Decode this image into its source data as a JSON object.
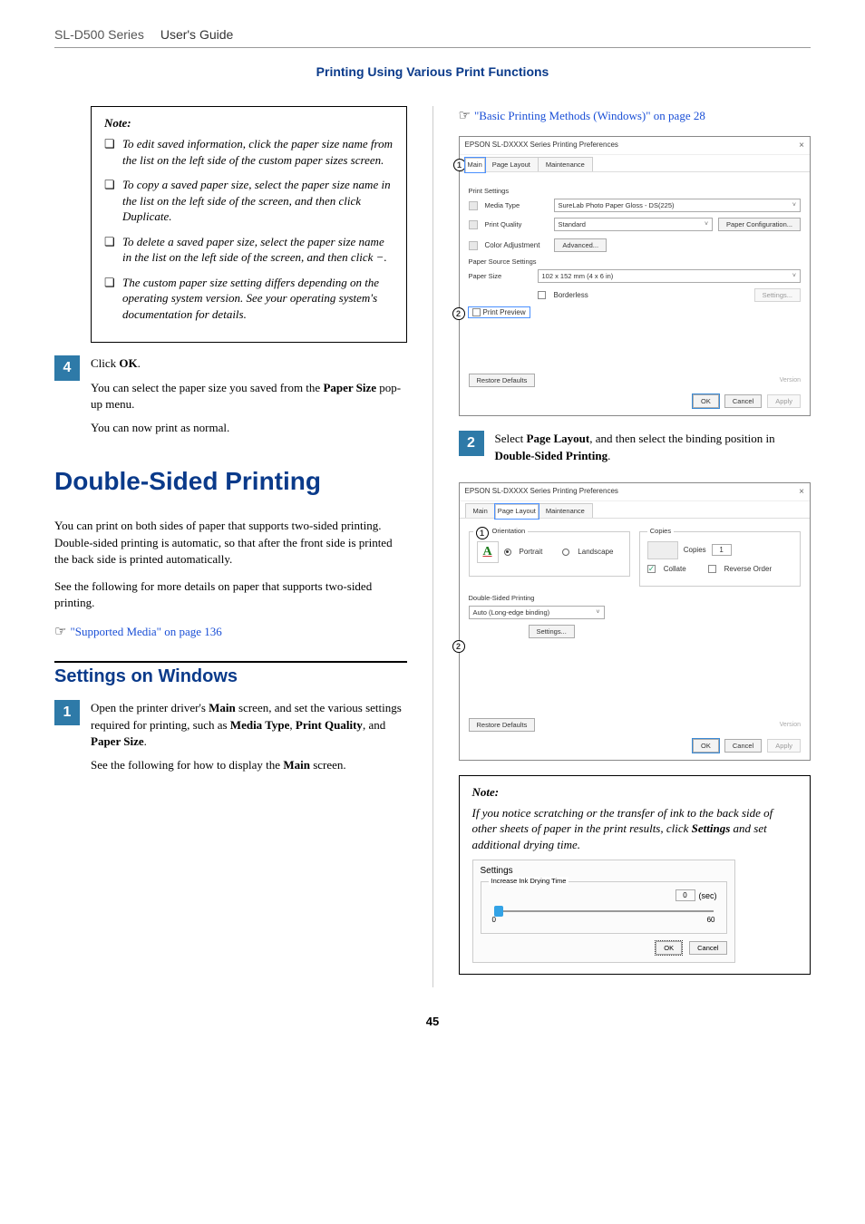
{
  "header": {
    "product": "SL-D500 Series",
    "guide": "User's Guide",
    "section": "Printing Using Various Print Functions"
  },
  "left": {
    "noteHead": "Note:",
    "notes": [
      "To edit saved information, click the paper size name from the list on the left side of the custom paper sizes screen.",
      "To copy a saved paper size, select the paper size name in the list on the left side of the screen, and then click Duplicate.",
      "To delete a saved paper size, select the paper size name in the list on the left side of the screen, and then click −.",
      "The custom paper size setting differs depending on the operating system version. See your operating system's documentation for details."
    ],
    "step4": {
      "num": "4",
      "line1_a": "Click ",
      "line1_b": "OK",
      "line1_c": ".",
      "p2_a": "You can select the paper size you saved from the ",
      "p2_b": "Paper Size",
      "p2_c": " pop-up menu.",
      "p3": "You can now print as normal."
    },
    "h1": "Double-Sided Printing",
    "body1": "You can print on both sides of paper that supports two-sided printing. Double-sided printing is automatic, so that after the front side is printed the back side is printed automatically.",
    "body2": "See the following for more details on paper that supports two-sided printing.",
    "link1": "\"Supported Media\" on page 136",
    "h2": "Settings on Windows",
    "step1": {
      "num": "1",
      "p1_a": "Open the printer driver's ",
      "p1_b": "Main",
      "p1_c": " screen, and set the various settings required for printing, such as ",
      "p1_d": "Media Type",
      "p1_e": ", ",
      "p1_f": "Print Quality",
      "p1_g": ", and ",
      "p1_h": "Paper Size",
      "p1_i": ".",
      "p2_a": "See the following for how to display the ",
      "p2_b": "Main",
      "p2_c": " screen."
    }
  },
  "right": {
    "linkTop_a": "\"Basic Printing Methods (Windows)\" on page 28",
    "dlg1": {
      "title": "EPSON SL-DXXXX Series Printing Preferences",
      "tabs": [
        "Main",
        "Page Layout",
        "Maintenance"
      ],
      "activeTab": 0,
      "callouts": [
        "1",
        "2"
      ],
      "printSettings": "Print Settings",
      "mediaTypeLbl": "Media Type",
      "mediaTypeVal": "SureLab Photo Paper Gloss - DS(225)",
      "printQualityLbl": "Print Quality",
      "printQualityVal": "Standard",
      "paperConfigBtn": "Paper Configuration...",
      "colorAdj": "Color Adjustment",
      "advancedBtn": "Advanced...",
      "paperSource": "Paper Source Settings",
      "paperSizeLbl": "Paper Size",
      "paperSizeVal": "102 x 152 mm (4 x 6 in)",
      "borderless": "Borderless",
      "settingsBtn": "Settings...",
      "printPreview": "Print Preview",
      "restore": "Restore Defaults",
      "version": "Version",
      "ok": "OK",
      "cancel": "Cancel",
      "apply": "Apply"
    },
    "step2": {
      "num": "2",
      "p_a": "Select ",
      "p_b": "Page Layout",
      "p_c": ", and then select the binding position in ",
      "p_d": "Double-Sided Printing",
      "p_e": "."
    },
    "dlg2": {
      "title": "EPSON SL-DXXXX Series Printing Preferences",
      "tabs": [
        "Main",
        "Page Layout",
        "Maintenance"
      ],
      "activeTab": 1,
      "callouts": [
        "1",
        "2"
      ],
      "orientation": "Orientation",
      "portrait": "Portrait",
      "landscape": "Landscape",
      "copies": "Copies",
      "copiesLbl": "Copies",
      "copiesVal": "1",
      "collate": "Collate",
      "reverse": "Reverse Order",
      "dsp": "Double-Sided Printing",
      "dspVal": "Auto (Long-edge binding)",
      "settingsBtn": "Settings...",
      "restore": "Restore Defaults",
      "version": "Version",
      "ok": "OK",
      "cancel": "Cancel",
      "apply": "Apply"
    },
    "note2Head": "Note:",
    "note2_a": "If you notice scratching or the transfer of ink to the back side of other sheets of paper in the print results, click ",
    "note2_b": "Settings",
    "note2_c": " and set additional drying time.",
    "settingsDlg": {
      "title": "Settings",
      "group": "Increase Ink Drying Time",
      "min": "0",
      "max": "60",
      "val": "0",
      "unit": "(sec)",
      "ok": "OK",
      "cancel": "Cancel"
    }
  },
  "pageNum": "45"
}
